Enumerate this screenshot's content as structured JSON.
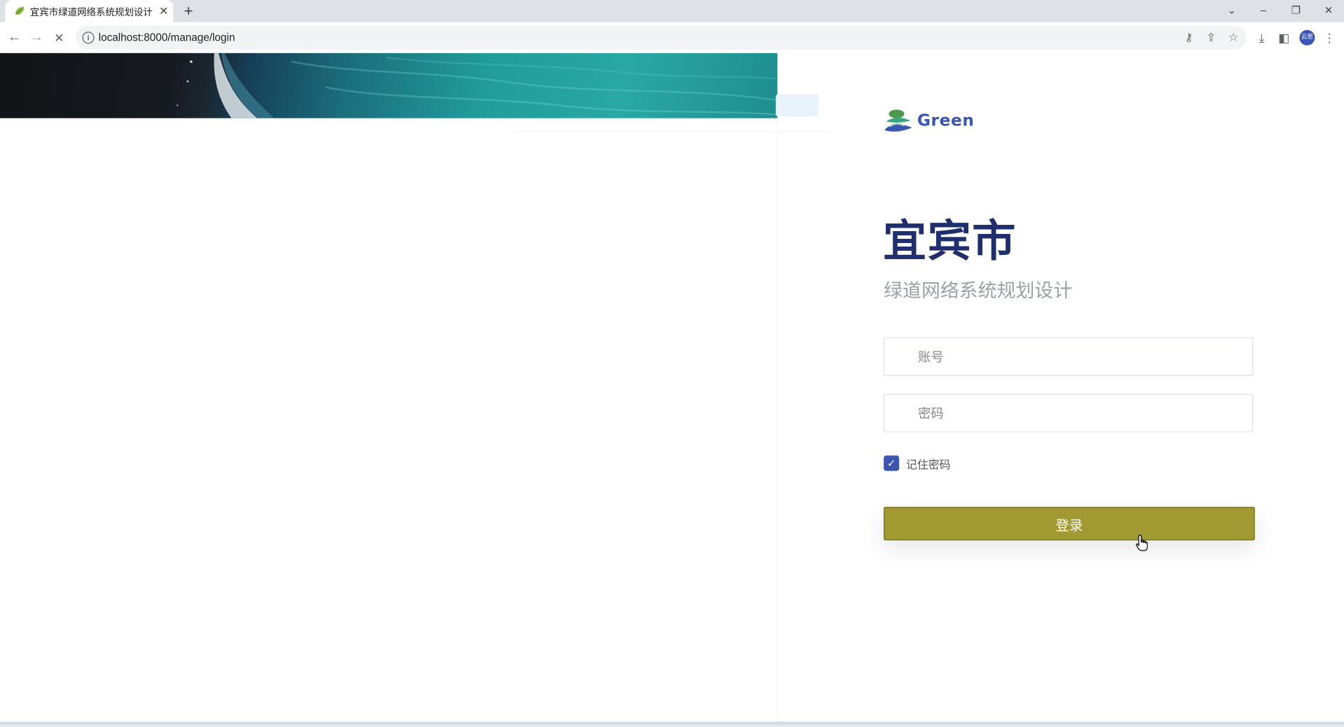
{
  "browser": {
    "tab": {
      "title": "宜宾市绿道网络系统规划设计",
      "close_glyph": "✕"
    },
    "new_tab_glyph": "+",
    "window_controls": {
      "tab_search": "⌄",
      "minimize": "–",
      "restore": "❐",
      "close": "✕"
    },
    "nav": {
      "back": "←",
      "forward": "→",
      "stop_loading": "✕"
    },
    "address": {
      "info_glyph": "i",
      "url": "localhost:8000/manage/login"
    },
    "omnibox_icons": {
      "password_key": "⚷",
      "share": "⇪",
      "bookmark": "☆"
    },
    "toolbar_icons": {
      "download": "⤓",
      "side_panel": "◧",
      "menu": "⋮"
    },
    "profile": {
      "initials": "云思",
      "color": "#3b56b8"
    }
  },
  "login_page": {
    "logo_text": "Green",
    "title": "宜宾市",
    "subtitle": "绿道网络系统规划设计",
    "account": {
      "placeholder": "账号",
      "value": ""
    },
    "password": {
      "placeholder": "密码",
      "value": ""
    },
    "remember": {
      "label": "记住密码",
      "checked": true,
      "check_glyph": "✓"
    },
    "login_button": "登录",
    "colors": {
      "title": "#1f2f6e",
      "subtitle": "#9aa1ab",
      "button": "#a19a32",
      "checkbox": "#3a55b2",
      "logo": "#3a56b4"
    }
  }
}
